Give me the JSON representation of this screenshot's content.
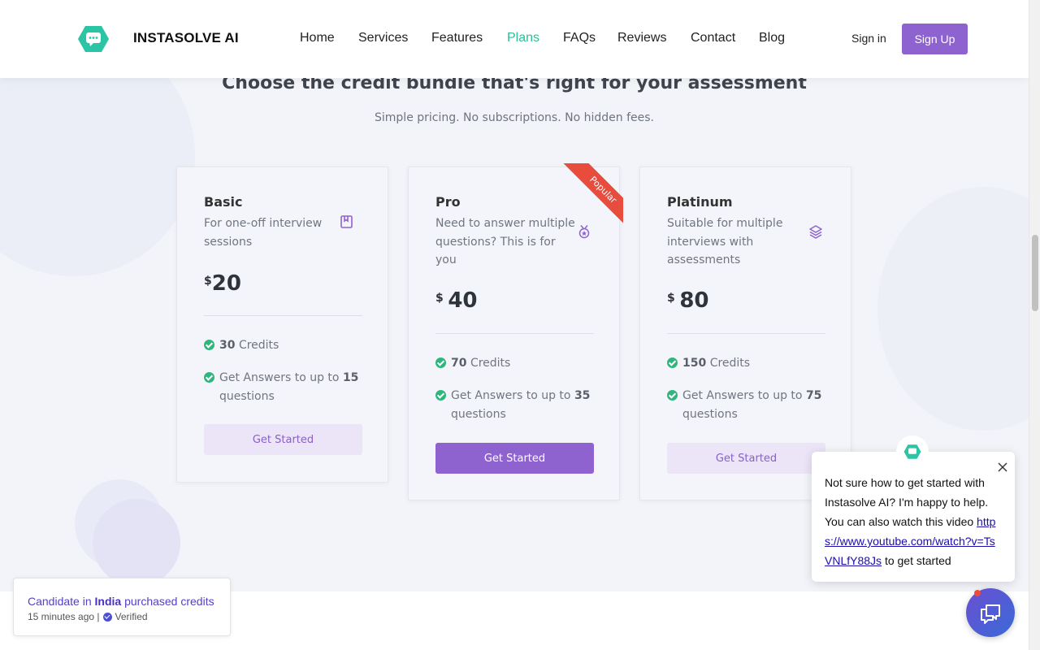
{
  "brand": {
    "name": "INSTASOLVE AI",
    "accent": "#2bbf98",
    "primary": "#8e62cf"
  },
  "nav": {
    "items": [
      {
        "label": "Home",
        "active": false
      },
      {
        "label": "Services",
        "active": false
      },
      {
        "label": "Features",
        "active": false
      },
      {
        "label": "Plans",
        "active": true
      },
      {
        "label": "FAQs",
        "active": false
      },
      {
        "label": "Reviews",
        "active": false
      },
      {
        "label": "Contact",
        "active": false
      },
      {
        "label": "Blog",
        "active": false
      }
    ],
    "signin": "Sign in",
    "signup": "Sign Up"
  },
  "pricing": {
    "title": "Choose the credit bundle that's right for your assessment",
    "subtitle": "Simple pricing. No subscriptions. No hidden fees.",
    "plans": [
      {
        "name": "Basic",
        "description": "For one-off interview sessions",
        "icon": "book-icon",
        "currency": "$",
        "price": "20",
        "credits_value": "30",
        "credits_label": "Credits",
        "answers_prefix": "Get Answers to up to",
        "answers_value": "15",
        "answers_suffix": "questions",
        "button": "Get Started",
        "featured": false
      },
      {
        "name": "Pro",
        "description": "Need to answer multiple questions? This is for you",
        "icon": "medal-icon",
        "currency": "$",
        "price": "40",
        "credits_value": "70",
        "credits_label": "Credits",
        "answers_prefix": "Get Answers to up to",
        "answers_value": "35",
        "answers_suffix": "questions",
        "button": "Get Started",
        "featured": true,
        "ribbon": "Popular"
      },
      {
        "name": "Platinum",
        "description": "Suitable for multiple interviews with assessments",
        "icon": "layers-icon",
        "currency": "$",
        "price": "80",
        "credits_value": "150",
        "credits_label": "Credits",
        "answers_prefix": "Get Answers to up to",
        "answers_value": "75",
        "answers_suffix": "questions",
        "button": "Get Started",
        "featured": false
      }
    ]
  },
  "chat": {
    "message": "Not sure how to get started with Instasolve AI? I'm happy to help. You can also watch this video",
    "link": "https://www.youtube.com/watch?v=TsVNLfY88Js",
    "suffix": "to get started"
  },
  "toast": {
    "prefix": "Candidate in",
    "country": "India",
    "suffix": "purchased credits",
    "time": "15 minutes ago |",
    "verified": "Verified"
  }
}
